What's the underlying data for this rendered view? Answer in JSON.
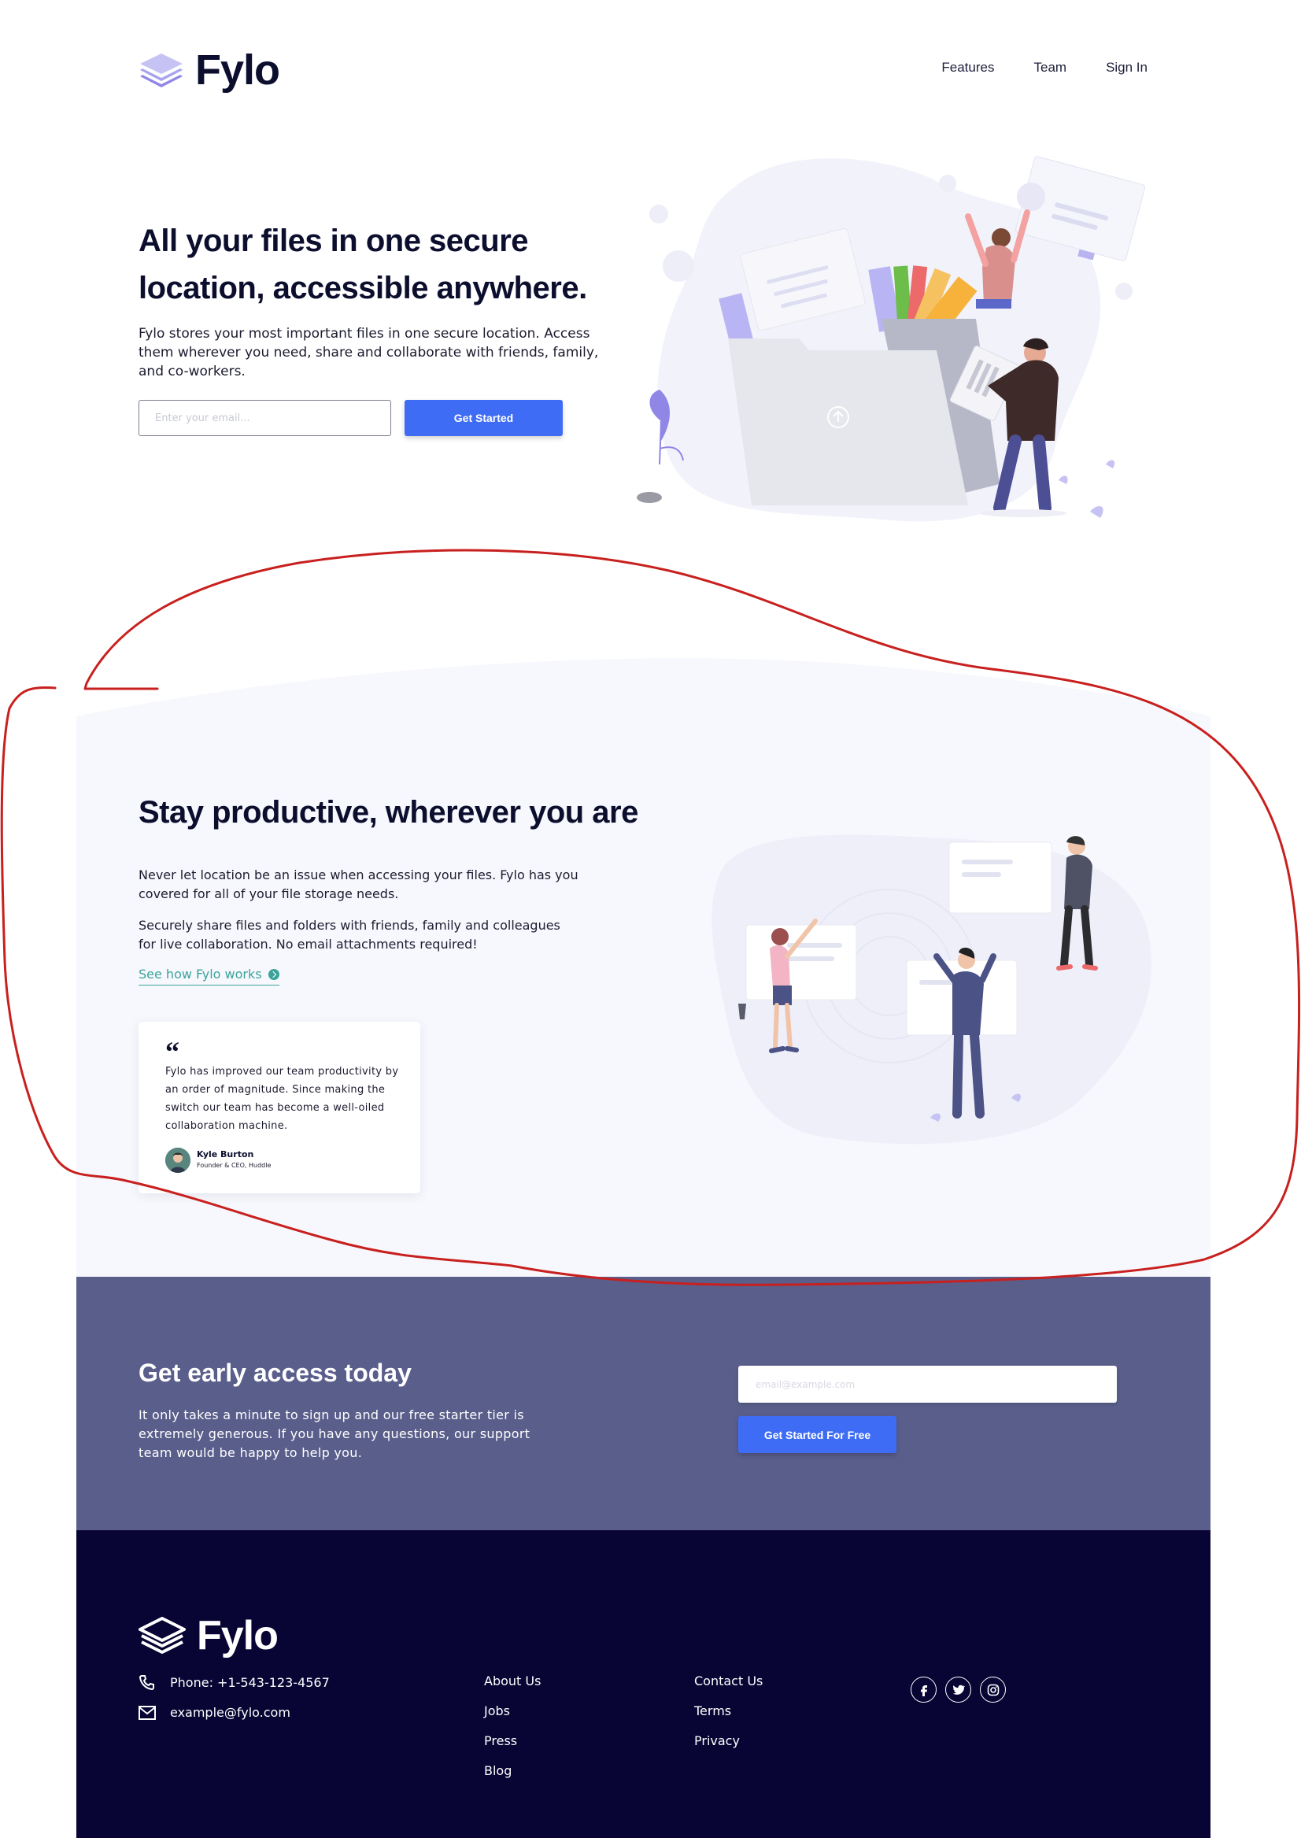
{
  "brand": {
    "name": "Fylo"
  },
  "nav": {
    "items": [
      "Features",
      "Team",
      "Sign In"
    ]
  },
  "hero": {
    "title": "All your files in one secure location, accessible anywhere.",
    "text": "Fylo stores your most important files in one secure location. Access them wherever you need, share and collaborate with friends, family, and co-workers.",
    "email_placeholder": "Enter your email...",
    "button_label": "Get Started"
  },
  "productive": {
    "title": "Stay productive, wherever you are",
    "p1": "Never let location be an issue when accessing your files. Fylo has you covered for all of your file storage needs.",
    "p2": "Securely share files and folders with friends, family and colleagues for live collaboration. No email attachments required!",
    "link_label": "See how Fylo works",
    "testimonial": {
      "quote_mark": "“",
      "text": "Fylo has improved our team productivity by an order of magnitude. Since making the switch our team has become a well-oiled collaboration machine.",
      "name": "Kyle Burton",
      "role": "Founder & CEO, Huddle"
    }
  },
  "early_access": {
    "title": "Get early access today",
    "text": "It only takes a minute to sign up and our free starter tier is extremely generous. If you have any questions, our support team would be happy to help you.",
    "email_placeholder": "email@example.com",
    "button_label": "Get Started For Free"
  },
  "footer": {
    "phone": "Phone: +1-543-123-4567",
    "email": "example@fylo.com",
    "links_col1": [
      "About Us",
      "Jobs",
      "Press",
      "Blog"
    ],
    "links_col2": [
      "Contact Us",
      "Terms",
      "Privacy"
    ],
    "social_icons": [
      "facebook-icon",
      "twitter-icon",
      "instagram-icon"
    ]
  },
  "colors": {
    "accent_blue": "#3f6cf5",
    "link_teal": "#3ca39b",
    "early_access_bg": "#5a5e8b",
    "footer_bg": "#080433",
    "section_bg": "#f7f8fd",
    "annotation_red": "#c8201e"
  }
}
